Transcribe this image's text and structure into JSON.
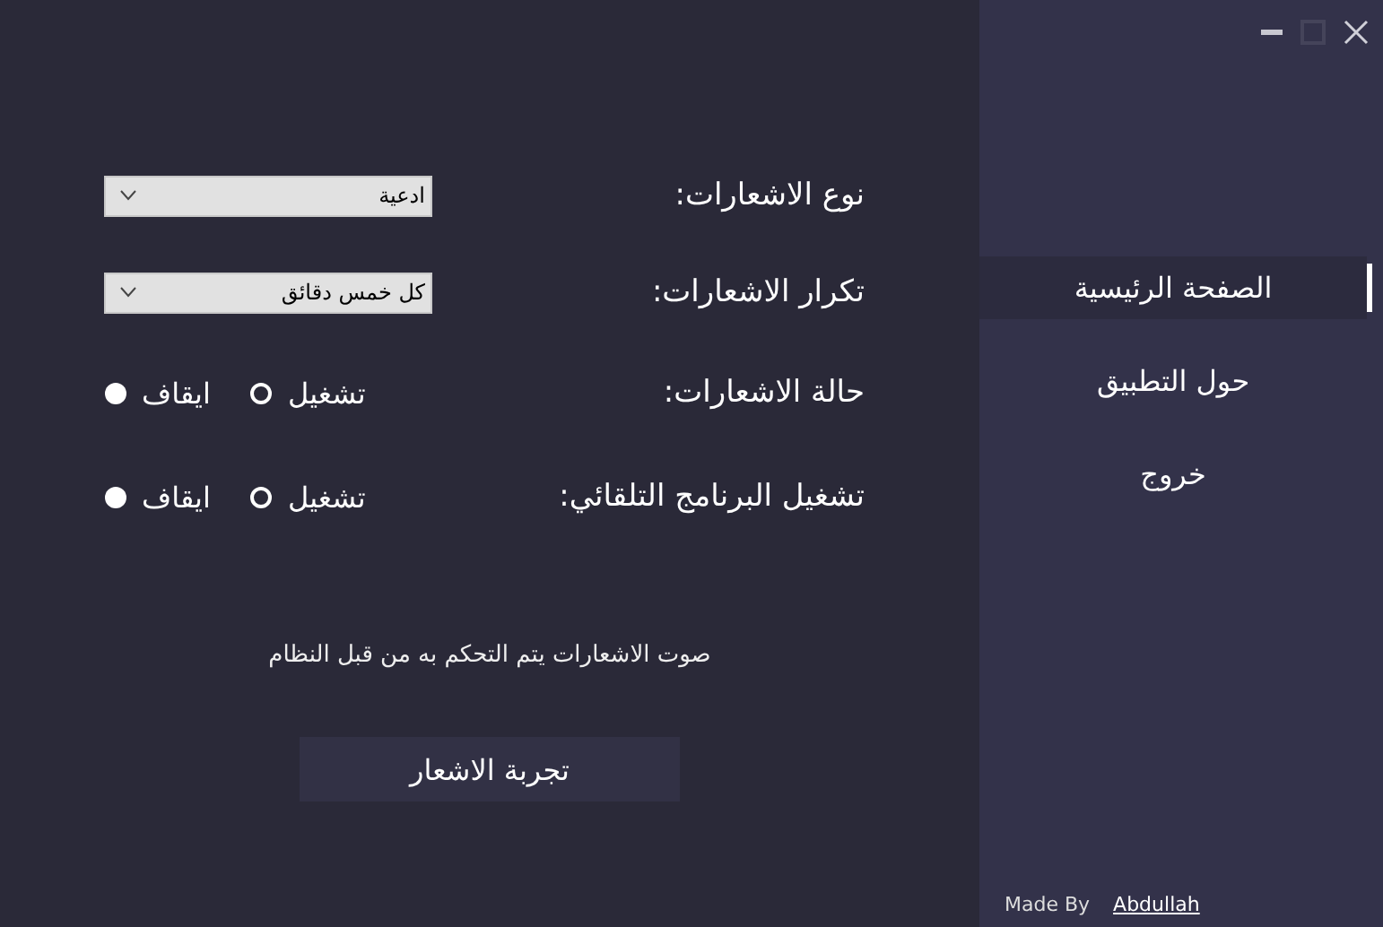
{
  "settings": [
    {
      "kind": "select",
      "label": "نوع الاشعارات:",
      "value": "ادعية"
    },
    {
      "kind": "select",
      "label": "تكرار الاشعارات:",
      "value": "كل خمس دقائق"
    },
    {
      "kind": "radio",
      "label": "حالة الاشعارات:",
      "options": [
        {
          "label": "تشغيل",
          "selected": false
        },
        {
          "label": "ايقاف",
          "selected": true
        }
      ]
    },
    {
      "kind": "radio",
      "label": "تشغيل البرنامج التلقائي:",
      "options": [
        {
          "label": "تشغيل",
          "selected": false
        },
        {
          "label": "ايقاف",
          "selected": true
        }
      ]
    }
  ],
  "note": "صوت الاشعارات يتم التحكم به من قبل النظام",
  "test_button": "تجربة الاشعار",
  "sidebar": {
    "items": [
      {
        "label": "الصفحة الرئيسية",
        "selected": true
      },
      {
        "label": "حول التطبيق",
        "selected": false
      },
      {
        "label": "خروج",
        "selected": false
      }
    ]
  },
  "footer": {
    "label": "Made By",
    "link": "Abdullah"
  }
}
